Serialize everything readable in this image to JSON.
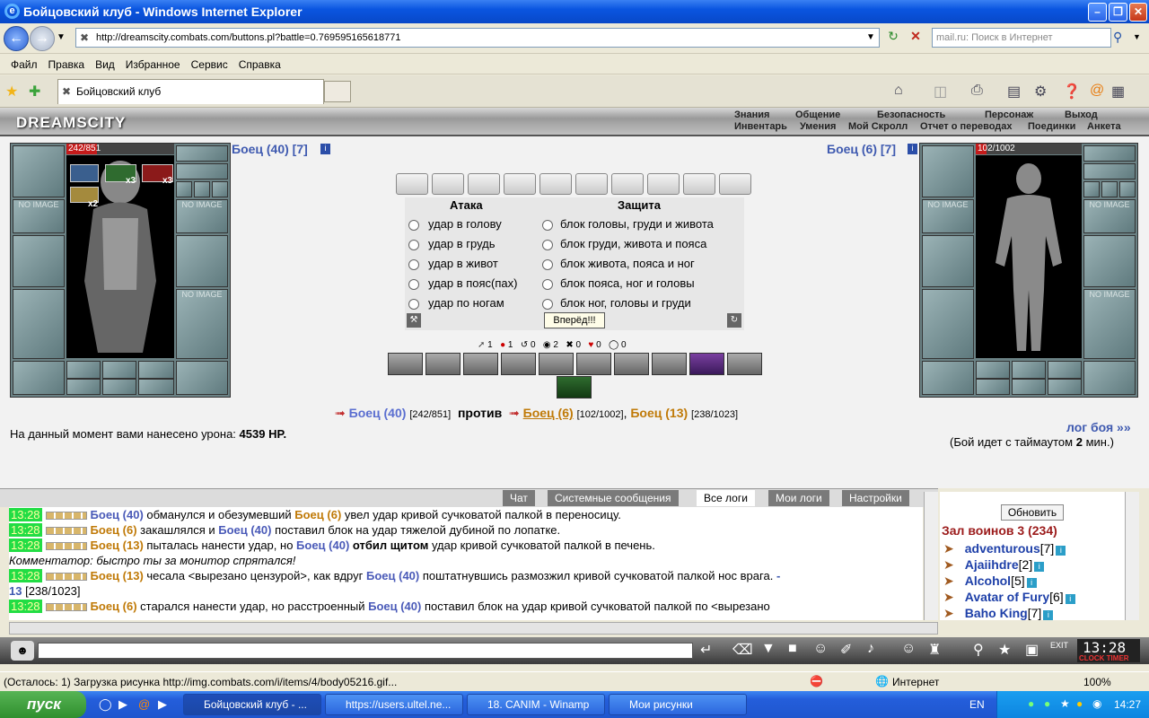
{
  "window": {
    "title": "Бойцовский клуб - Windows Internet Explorer"
  },
  "address": {
    "url": "http://dreamscity.combats.com/buttons.pl?battle=0.769595165618771",
    "search_placeholder": "mail.ru: Поиск в Интернет"
  },
  "menu": {
    "items": [
      "Файл",
      "Правка",
      "Вид",
      "Избранное",
      "Сервис",
      "Справка"
    ]
  },
  "tab": {
    "title": "Бойцовский клуб"
  },
  "game_header": {
    "logo": "DREAMSCITY",
    "top_links": [
      "Знания",
      "Общение",
      "Безопасность",
      "Персонаж",
      "Выход"
    ],
    "bottom_links": [
      "Инвентарь",
      "Умения",
      "Мой Скролл",
      "Отчет о переводах",
      "Поединки",
      "Анкета"
    ]
  },
  "player_left": {
    "name": "Боец (40) [7]",
    "hp": "242/851",
    "hp_fraction": 0.284,
    "badges": [
      "x3",
      "x3",
      "x2"
    ],
    "no_image": "NO IMAGE"
  },
  "player_right": {
    "name": "Боец (6) [7]",
    "hp": "102/1002",
    "hp_fraction": 0.102,
    "no_image": "NO IMAGE"
  },
  "attack": {
    "header": "Атака",
    "options": [
      "удар в голову",
      "удар в грудь",
      "удар в живот",
      "удар в пояс(пах)",
      "удар по ногам"
    ]
  },
  "defense": {
    "header": "Защита",
    "options": [
      "блок головы, груди и живота",
      "блок груди, живота и пояса",
      "блок живота, пояса и ног",
      "блок пояса, ног и головы",
      "блок ног, головы и груди"
    ]
  },
  "forward_button": "Вперёд!!!",
  "counters": [
    "1",
    "1",
    "0",
    "2",
    "0",
    "0",
    "0"
  ],
  "versus": {
    "me": "Боец (40)",
    "me_hp": "[242/851]",
    "vs": "против",
    "enemy1": "Боец (6)",
    "enemy1_hp": "[102/1002]",
    "sep": ",",
    "enemy2": "Боец (13)",
    "enemy2_hp": "[238/1023]"
  },
  "damage": {
    "label": "На данный момент вами нанесено урона:",
    "value": "4539 HP."
  },
  "battle_log_link": "лог боя »»",
  "timeout": {
    "prefix": "(Бой идет с таймаутом",
    "value": "2",
    "suffix": "мин.)"
  },
  "chat_tabs": [
    "Чат",
    "Системные сообщения",
    "Все логи",
    "Мои логи",
    "Настройки"
  ],
  "chat_lines": [
    {
      "time": "13:28",
      "parts": [
        [
          "p1",
          "Боец (40)"
        ],
        [
          "t",
          " обманулся и обезумевший "
        ],
        [
          "p2",
          "Боец (6)"
        ],
        [
          "t",
          " увел удар кривой сучковатой палкой в переносицу."
        ]
      ]
    },
    {
      "time": "13:28",
      "parts": [
        [
          "p2",
          "Боец (6)"
        ],
        [
          "t",
          " закашлялся и "
        ],
        [
          "p1",
          "Боец (40)"
        ],
        [
          "t",
          " поставил блок на удар тяжелой дубиной по лопатке."
        ]
      ]
    },
    {
      "time": "13:28",
      "parts": [
        [
          "p2",
          "Боец (13)"
        ],
        [
          "t",
          " пыталась нанести удар, но "
        ],
        [
          "p1",
          "Боец (40)"
        ],
        [
          "b",
          " отбил щитом"
        ],
        [
          "t",
          " удар кривой сучковатой палкой в печень."
        ]
      ]
    },
    {
      "time": "",
      "parts": [
        [
          "i",
          "Комментатор: быстро ты за монитор спрятался!"
        ]
      ]
    },
    {
      "time": "13:28",
      "parts": [
        [
          "p2",
          "Боец (13)"
        ],
        [
          "t",
          " чесала <вырезано цензурой>, как вдруг "
        ],
        [
          "p1",
          "Боец (40)"
        ],
        [
          "t",
          " поштатнувшись размозжил кривой сучковатой палкой нос врага. "
        ],
        [
          "d",
          "-"
        ]
      ]
    },
    {
      "time": "",
      "parts": [
        [
          "d",
          "13"
        ],
        [
          "t",
          " [238/1023]"
        ]
      ]
    },
    {
      "time": "13:28",
      "parts": [
        [
          "p2",
          "Боец (6)"
        ],
        [
          "t",
          " старался нанести удар, но расстроенный "
        ],
        [
          "p1",
          "Боец (40)"
        ],
        [
          "t",
          " поставил блок на удар кривой сучковатой палкой по <вырезано"
        ]
      ]
    }
  ],
  "right_panel": {
    "refresh": "Обновить",
    "room": "Зал воинов 3 (234)",
    "users": [
      {
        "name": "adventurous",
        "level": "[7]"
      },
      {
        "name": "Ajaiihdre",
        "level": "[2]"
      },
      {
        "name": "Alcohol",
        "level": "[5]"
      },
      {
        "name": "Avatar of Fury",
        "level": "[6]"
      },
      {
        "name": "Baho King",
        "level": "[7]"
      }
    ]
  },
  "clock": {
    "time": "13:28",
    "label": "CLOCK TIMER"
  },
  "status": {
    "text": "(Осталось: 1) Загрузка рисунка http://img.combats.com/i/items/4/body05216.gif...",
    "zone": "Интернет",
    "zoom": "100%"
  },
  "taskbar": {
    "start": "пуск",
    "tasks": [
      "Бойцовский клуб - ...",
      "https://users.ultel.ne...",
      "18. CANIM - Winamp",
      "Мои рисунки"
    ],
    "lang": "EN",
    "time": "14:27"
  }
}
